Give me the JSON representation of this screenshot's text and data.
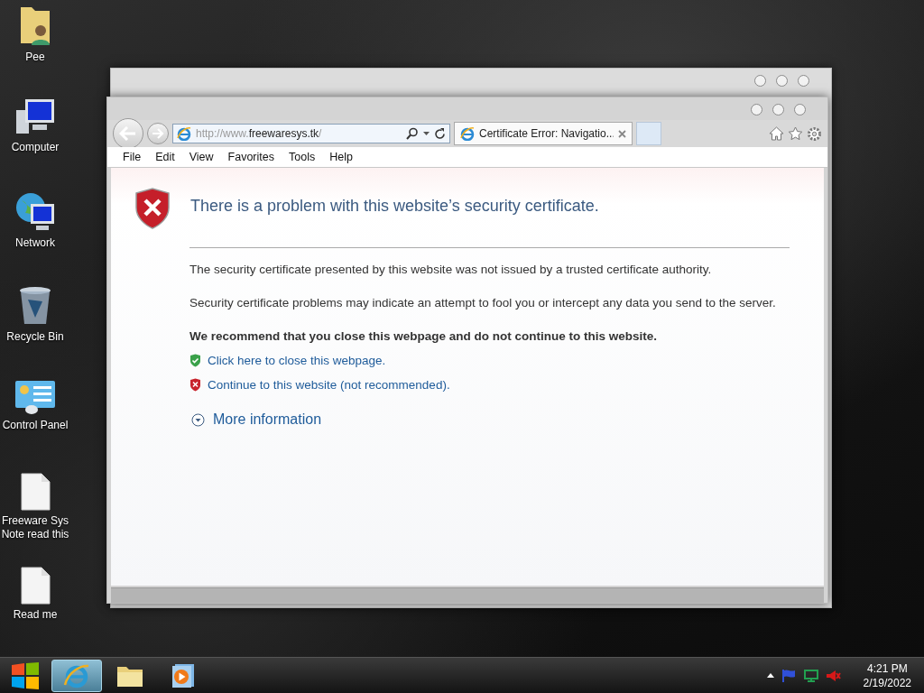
{
  "desktop_icons": [
    {
      "label": "Pee",
      "kind": "user-folder"
    },
    {
      "label": "Computer",
      "kind": "computer"
    },
    {
      "label": "Network",
      "kind": "network"
    },
    {
      "label": "Recycle Bin",
      "kind": "recycle"
    },
    {
      "label": "Control Panel",
      "kind": "control-panel"
    },
    {
      "label": "Freeware Sys Note read this",
      "kind": "document"
    },
    {
      "label": "Read me",
      "kind": "document"
    }
  ],
  "browser": {
    "address": {
      "prefix": "http://www.",
      "domain": "freewaresys.tk",
      "suffix": "/"
    },
    "tabs": [
      {
        "title": "Certificate Error: Navigatio...",
        "selected": true
      }
    ],
    "menu": [
      "File",
      "Edit",
      "View",
      "Favorites",
      "Tools",
      "Help"
    ],
    "page": {
      "heading": "There is a problem with this website’s security certificate.",
      "paragraphs": [
        "The security certificate presented by this website was not issued by a trusted certificate authority.",
        "Security certificate problems may indicate an attempt to fool you or intercept any data you send to the server."
      ],
      "recommendation": "We recommend that you close this webpage and do not continue to this website.",
      "links": [
        {
          "text": "Click here to close this webpage.",
          "kind": "safe"
        },
        {
          "text": "Continue to this website (not recommended).",
          "kind": "unsafe"
        }
      ],
      "more_info": "More information"
    }
  },
  "taskbar": {
    "buttons": [
      {
        "kind": "start",
        "selected": false
      },
      {
        "kind": "browser",
        "selected": true
      },
      {
        "kind": "folder",
        "selected": false
      },
      {
        "kind": "media",
        "selected": false
      }
    ],
    "time": "4:21 PM",
    "date": "2/19/2022"
  }
}
